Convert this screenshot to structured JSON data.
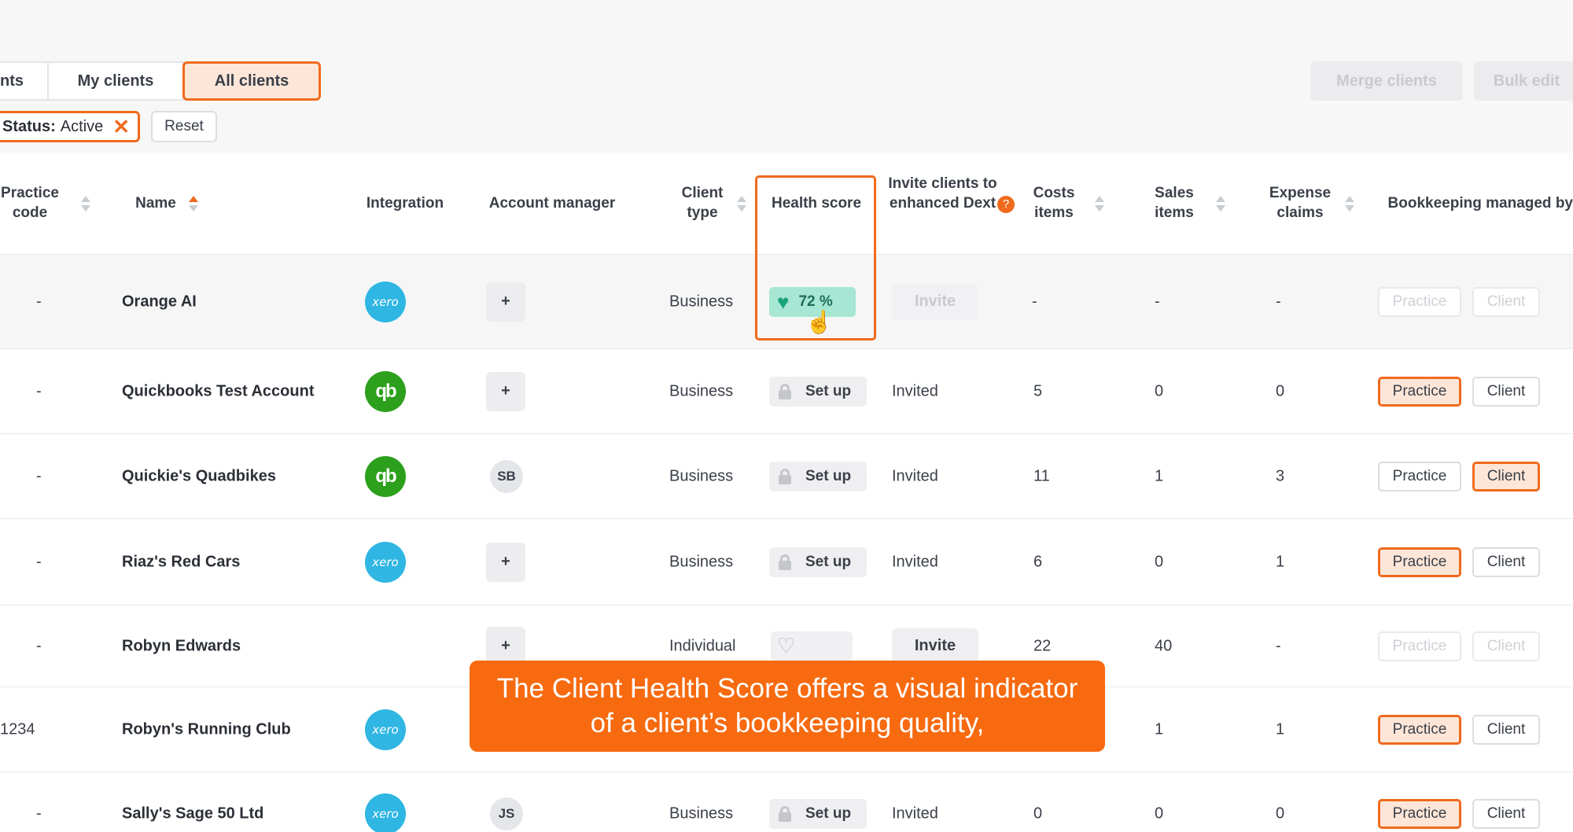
{
  "tabs": [
    {
      "label": "nts",
      "active": false
    },
    {
      "label": "My clients",
      "active": false
    },
    {
      "label": "All clients",
      "active": true
    }
  ],
  "actions": {
    "merge": "Merge clients",
    "bulk_edit": "Bulk edit"
  },
  "filter": {
    "key": "Status:",
    "value": "Active",
    "remove_icon": "close-icon",
    "reset": "Reset"
  },
  "columns": {
    "practice_code": "Practice code",
    "name": "Name",
    "integration": "Integration",
    "account_manager": "Account manager",
    "client_type": "Client type",
    "health_score": "Health score",
    "invite": "Invite clients to enhanced Dext",
    "invite_help": "?",
    "costs": "Costs items",
    "sales": "Sales items",
    "expense": "Expense claims",
    "bookkeeping": "Bookkeeping managed by"
  },
  "rows": [
    {
      "code": "-",
      "name": "Orange AI",
      "integration": "xero",
      "manager": "+",
      "type": "Business",
      "health": "72 %",
      "invite": "Invite",
      "costs": "-",
      "sales": "-",
      "expense": "-",
      "practice": "Practice",
      "client": "Client",
      "managed_by": "none"
    },
    {
      "code": "-",
      "name": "Quickbooks Test Account",
      "integration": "qb",
      "manager": "+",
      "type": "Business",
      "health": "Set up",
      "invite": "Invited",
      "costs": "5",
      "sales": "0",
      "expense": "0",
      "practice": "Practice",
      "client": "Client",
      "managed_by": "practice"
    },
    {
      "code": "-",
      "name": "Quickie's Quadbikes",
      "integration": "qb",
      "manager": "SB",
      "type": "Business",
      "health": "Set up",
      "invite": "Invited",
      "costs": "11",
      "sales": "1",
      "expense": "3",
      "practice": "Practice",
      "client": "Client",
      "managed_by": "client"
    },
    {
      "code": "-",
      "name": "Riaz's Red Cars",
      "integration": "xero",
      "manager": "+",
      "type": "Business",
      "health": "Set up",
      "invite": "Invited",
      "costs": "6",
      "sales": "0",
      "expense": "1",
      "practice": "Practice",
      "client": "Client",
      "managed_by": "practice"
    },
    {
      "code": "-",
      "name": "Robyn Edwards",
      "integration": "",
      "manager": "+",
      "type": "Individual",
      "health": "",
      "invite": "Invite",
      "costs": "22",
      "sales": "40",
      "expense": "-",
      "practice": "Practice",
      "client": "Client",
      "managed_by": "none"
    },
    {
      "code": "1234",
      "name": "Robyn's Running Club",
      "integration": "xero",
      "manager": "",
      "type": "",
      "health": "",
      "invite": "",
      "costs": "",
      "sales": "1",
      "expense": "1",
      "practice": "Practice",
      "client": "Client",
      "managed_by": "practice"
    },
    {
      "code": "-",
      "name": "Sally's Sage 50 Ltd",
      "integration": "xero",
      "manager": "JS",
      "type": "Business",
      "health": "Set up",
      "invite": "Invited",
      "costs": "0",
      "sales": "0",
      "expense": "0",
      "practice": "Practice",
      "client": "Client",
      "managed_by": "practice"
    }
  ],
  "logos": {
    "xero": "xero",
    "qb": "qb"
  },
  "caption": {
    "line1": "The Client Health Score offers a visual indicator",
    "line2": "of a client’s bookkeeping quality,"
  },
  "colors": {
    "accent": "#f06a1d",
    "health_good": "#a7e6d3",
    "banner": "#f76a0f"
  }
}
